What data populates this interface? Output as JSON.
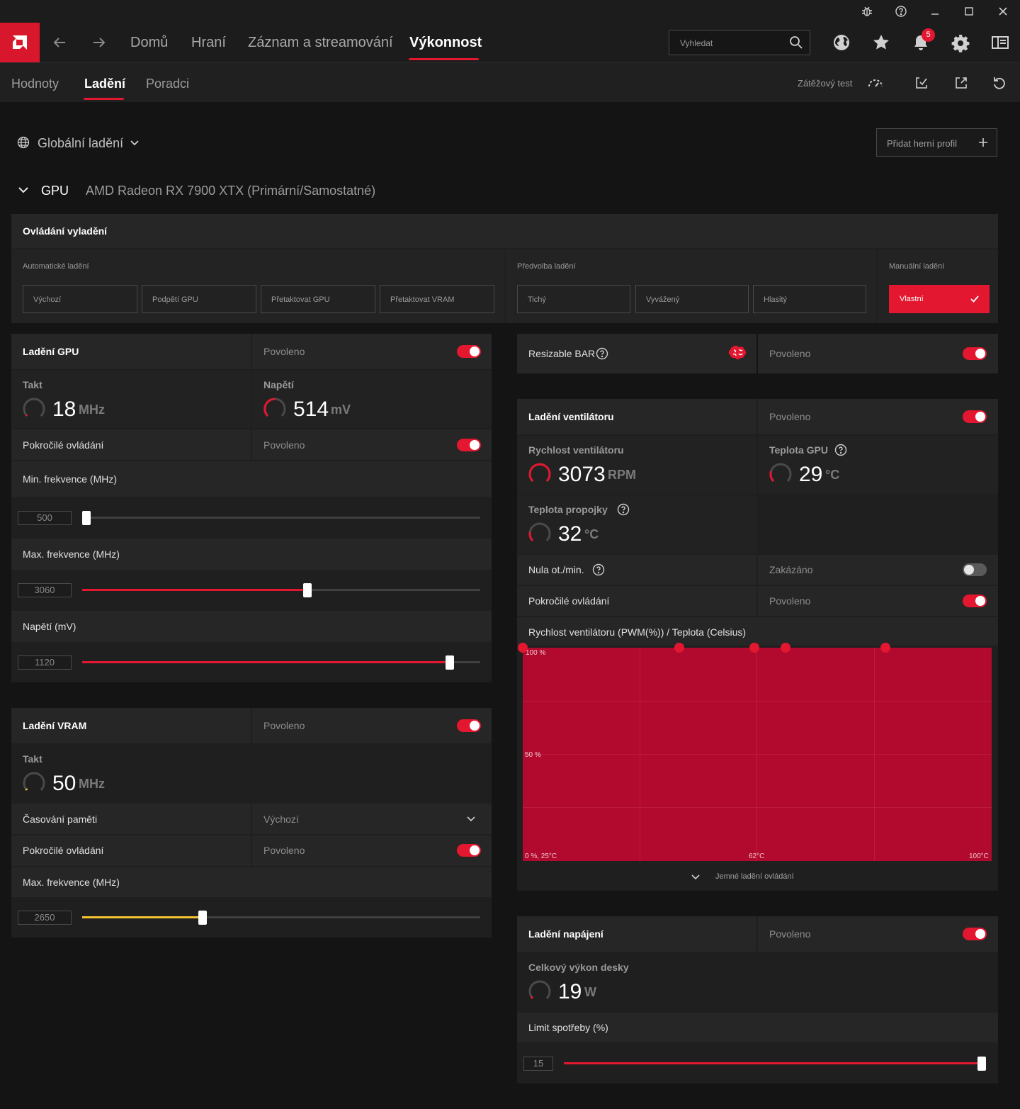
{
  "window": {
    "controls": [
      "bug-icon",
      "help-icon",
      "minimize-icon",
      "maximize-icon",
      "close-icon"
    ]
  },
  "nav": {
    "links": [
      "Domů",
      "Hraní",
      "Záznam a streamování",
      "Výkonnost"
    ],
    "active": "Výkonnost",
    "search_placeholder": "Vyhledat",
    "notification_count": "5"
  },
  "subnav": {
    "tabs": [
      "Hodnoty",
      "Ladění",
      "Poradci"
    ],
    "active": "Ladění",
    "stress_test": "Zátěžový test"
  },
  "profile": {
    "scope": "Globální ladění",
    "add_profile": "Přidat herní profil"
  },
  "gpu": {
    "label": "GPU",
    "name": "AMD Radeon RX 7900 XTX (Primární/Samostatné)"
  },
  "tuning_control": {
    "title": "Ovládání vyladění",
    "auto": {
      "label": "Automatické ladění",
      "options": [
        "Výchozí",
        "Podpětí GPU",
        "Přetaktovat GPU",
        "Přetaktovat VRAM"
      ]
    },
    "preset": {
      "label": "Předvolba ladění",
      "options": [
        "Tichý",
        "Vyvážený",
        "Hlasitý"
      ]
    },
    "manual": {
      "label": "Manuální ladění",
      "selected": "Vlastní"
    }
  },
  "gpu_tuning": {
    "title": "Ladění GPU",
    "status": "Povoleno",
    "enabled": true,
    "clock": {
      "label": "Takt",
      "value": "18",
      "unit": "MHz"
    },
    "voltage": {
      "label": "Napětí",
      "value": "514",
      "unit": "mV"
    },
    "advanced": {
      "label": "Pokročilé ovládání",
      "status": "Povoleno",
      "enabled": true
    },
    "min_freq": {
      "label": "Min. frekvence (MHz)",
      "value": "500",
      "fraction": 0.0
    },
    "max_freq": {
      "label": "Max. frekvence (MHz)",
      "value": "3060",
      "fraction": 0.56
    },
    "voltage_mv": {
      "label": "Napětí (mV)",
      "value": "1120",
      "fraction": 0.92
    }
  },
  "vram_tuning": {
    "title": "Ladění VRAM",
    "status": "Povoleno",
    "enabled": true,
    "clock": {
      "label": "Takt",
      "value": "50",
      "unit": "MHz"
    },
    "timing": {
      "label": "Časování paměti",
      "value": "Výchozí"
    },
    "advanced": {
      "label": "Pokročilé ovládání",
      "status": "Povoleno",
      "enabled": true
    },
    "max_freq": {
      "label": "Max. frekvence (MHz)",
      "value": "2650",
      "fraction": 0.3
    }
  },
  "resizable_bar": {
    "label": "Resizable BAR",
    "status": "Povoleno",
    "enabled": true
  },
  "fan_tuning": {
    "title": "Ladění ventilátoru",
    "status": "Povoleno",
    "enabled": true,
    "fan_speed": {
      "label": "Rychlost ventilátoru",
      "value": "3073",
      "unit": "RPM"
    },
    "gpu_temp": {
      "label": "Teplota GPU",
      "value": "29",
      "unit": "°C"
    },
    "junction_temp": {
      "label": "Teplota propojky",
      "value": "32",
      "unit": "°C"
    },
    "zero_rpm": {
      "label": "Nula ot./min.",
      "status": "Zakázáno",
      "enabled": false
    },
    "advanced": {
      "label": "Pokročilé ovládání",
      "status": "Povoleno",
      "enabled": true
    },
    "fine_tune": "Jemné ladění ovládání"
  },
  "chart_data": {
    "type": "area",
    "title": "Rychlost ventilátoru (PWM(%)) / Teplota (Celsius)",
    "x_tick_labels": [
      "0 %, 25°C",
      "62°C",
      "100°C"
    ],
    "y_tick_labels": [
      "100 %",
      "50 %"
    ],
    "x_unit": "°C",
    "y_unit": "%",
    "xlim": [
      25,
      100
    ],
    "ylim": [
      0,
      100
    ],
    "series": [
      {
        "x": [
          25,
          50,
          62,
          67,
          83
        ],
        "y": [
          100,
          100,
          100,
          100,
          100
        ]
      }
    ],
    "colors": {
      "fill": "#b10a2e",
      "point": "#e3172f"
    }
  },
  "power_tuning": {
    "title": "Ladění napájení",
    "status": "Povoleno",
    "enabled": true,
    "board_power": {
      "label": "Celkový výkon desky",
      "value": "19",
      "unit": "W"
    },
    "power_limit": {
      "label": "Limit spotřeby (%)",
      "value": "15",
      "fraction": 1.0
    }
  },
  "colors": {
    "accent": "#e3172f",
    "vram_accent": "#f5c431",
    "background": "#141414",
    "panel": "#1f1f1f"
  }
}
